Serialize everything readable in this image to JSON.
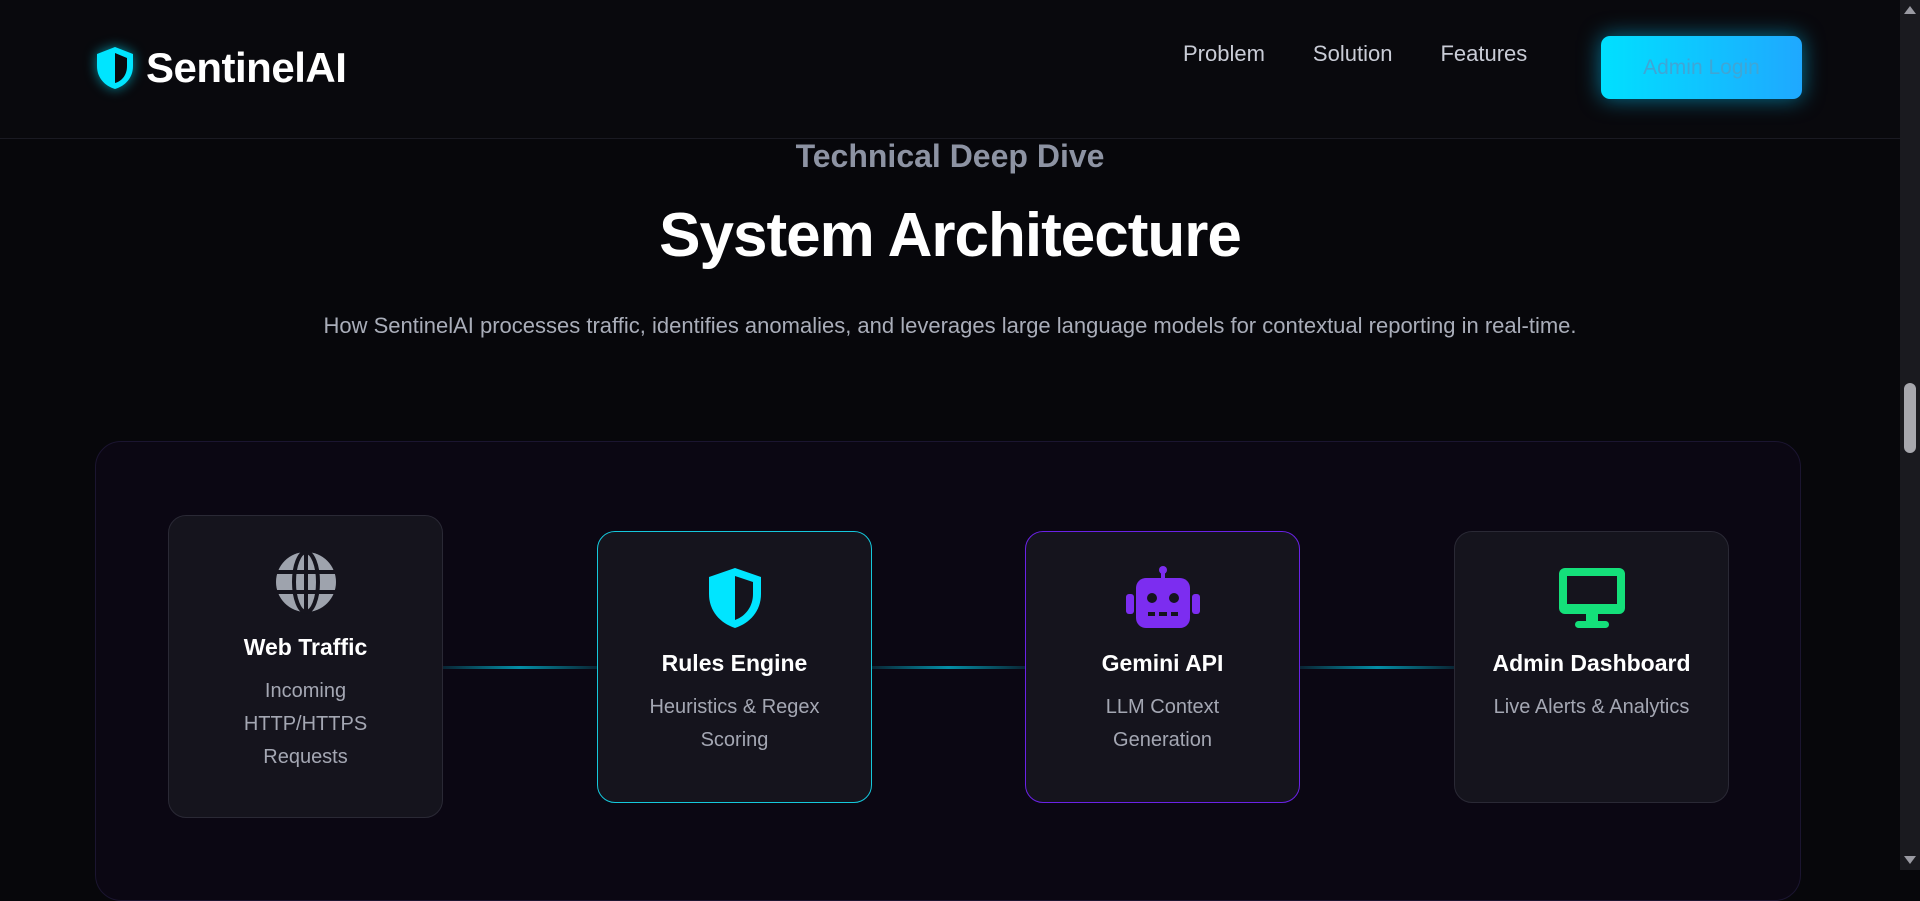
{
  "brand": {
    "name": "SentinelAI",
    "icon": "shield-half-icon",
    "accent_color": "#00e5ff"
  },
  "nav": {
    "items": [
      {
        "label": "Problem"
      },
      {
        "label": "Solution"
      },
      {
        "label": "Features"
      }
    ],
    "login_label": "Admin Login"
  },
  "hero": {
    "eyebrow": "Technical Deep Dive",
    "title": "System Architecture",
    "subtitle": "How SentinelAI processes traffic, identifies anomalies, and leverages large language models for contextual reporting in real-time."
  },
  "architecture": {
    "steps": [
      {
        "title": "Web Traffic",
        "desc": "Incoming HTTP/HTTPS Requests",
        "icon": "globe-icon",
        "icon_color": "#9ea3ad"
      },
      {
        "title": "Rules Engine",
        "desc": "Heuristics & Regex Scoring",
        "icon": "shield-half-icon",
        "icon_color": "#00e5ff"
      },
      {
        "title": "Gemini API",
        "desc": "LLM Context Generation",
        "icon": "robot-icon",
        "icon_color": "#7c2df0"
      },
      {
        "title": "Admin Dashboard",
        "desc": "Live Alerts & Analytics",
        "icon": "desktop-icon",
        "icon_color": "#14e07a"
      }
    ]
  }
}
